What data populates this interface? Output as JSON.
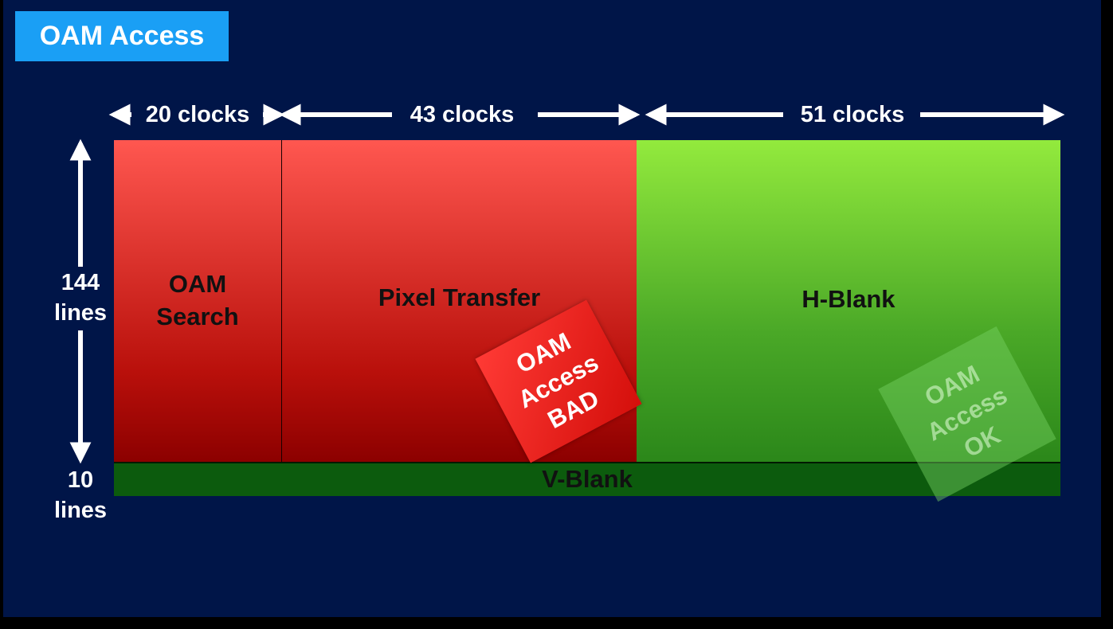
{
  "slide": {
    "title": "OAM Access",
    "background_color": "#001548",
    "title_color": "#1a9ff5"
  },
  "clocks": {
    "oam_search": "20 clocks",
    "pixel_transfer": "43 clocks",
    "h_blank": "51 clocks"
  },
  "lines": {
    "visible_count": "144",
    "visible_unit": "lines",
    "vblank_count": "10",
    "vblank_unit": "lines"
  },
  "modes": {
    "oam_search_line1": "OAM",
    "oam_search_line2": "Search",
    "pixel_transfer": "Pixel Transfer",
    "h_blank": "H-Blank",
    "v_blank": "V-Blank"
  },
  "stamps": {
    "bad": [
      "OAM",
      "Access",
      "BAD"
    ],
    "ok": [
      "OAM",
      "Access",
      "OK"
    ]
  },
  "colors": {
    "red": "#d41a14",
    "green": "#5fbf2e",
    "vblank_green": "#0c5b0d"
  }
}
